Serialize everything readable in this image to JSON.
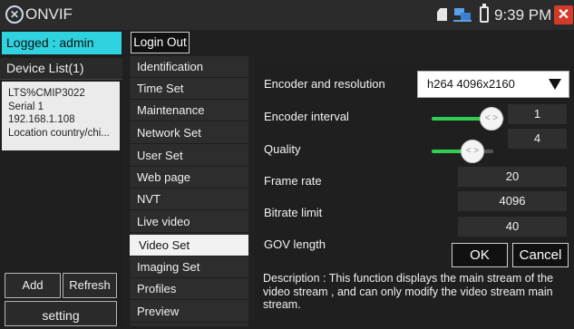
{
  "statusbar": {
    "app_title": "ONVIF",
    "time": "9:39 PM",
    "icons": [
      "onvif-logo-icon",
      "sd-card-icon",
      "network-icon",
      "battery-icon",
      "close-icon"
    ],
    "close_color": "#d23a2a"
  },
  "left": {
    "logged": "Logged : admin",
    "device_list_header": "Device List(1)",
    "device": {
      "name": "LTS%CMIP3022",
      "serial": "Serial  1",
      "ip": "192.168.1.108",
      "location": "Location country/chi..."
    },
    "add_label": "Add",
    "refresh_label": "Refresh",
    "setting_label": "setting"
  },
  "login_out": "Login Out",
  "menu": {
    "items": [
      {
        "label": "Identification"
      },
      {
        "label": "Time Set"
      },
      {
        "label": "Maintenance"
      },
      {
        "label": "Network Set"
      },
      {
        "label": "User Set"
      },
      {
        "label": "Web page"
      },
      {
        "label": "NVT"
      },
      {
        "label": "Live video"
      },
      {
        "label": "Video Set"
      },
      {
        "label": "Imaging Set"
      },
      {
        "label": "Profiles"
      },
      {
        "label": "Preview"
      }
    ],
    "active": "Video Set"
  },
  "video_set": {
    "encoder_resolution_label": "Encoder and resolution",
    "encoder_resolution_value": "h264 4096x2160",
    "encoder_interval_label": "Encoder interval",
    "encoder_interval_value": "1",
    "encoder_interval_level": 0.9,
    "quality_label": "Quality",
    "quality_value": "4",
    "quality_level": 0.7,
    "frame_rate_label": "Frame rate",
    "frame_rate_value": "20",
    "bitrate_label": "Bitrate limit",
    "bitrate_value": "4096",
    "gov_label": "GOV length",
    "gov_value": "40",
    "slider_thumb_glyph": "< >",
    "ok_label": "OK",
    "cancel_label": "Cancel",
    "description": "Description : This function displays the main stream of the video stream , and can only modify the video stream main stream.",
    "accent_color": "#2fcf4f"
  }
}
